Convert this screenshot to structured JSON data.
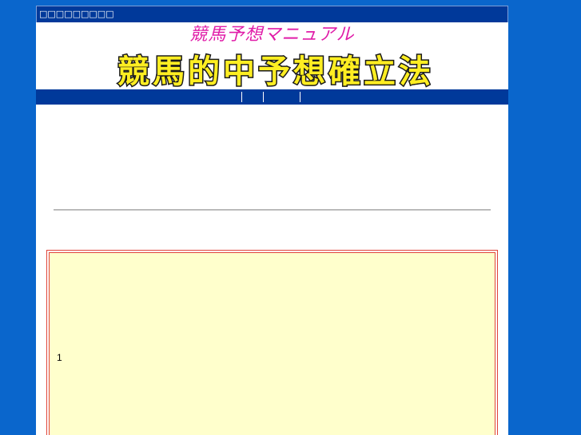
{
  "header": {
    "topbar_text": "□□□□□□□□□",
    "subtitle": "競馬予想マニュアル",
    "title": "競馬的中予想確立法"
  },
  "colors": {
    "background": "#0a66cc",
    "navy": "#00399a",
    "subtitle": "#e01ca8",
    "title_fill": "#ffee22",
    "title_stroke": "#1a1a1a",
    "box_border": "#e0443a",
    "box_fill": "#ffffcc"
  },
  "content": {
    "box_text": "1"
  }
}
